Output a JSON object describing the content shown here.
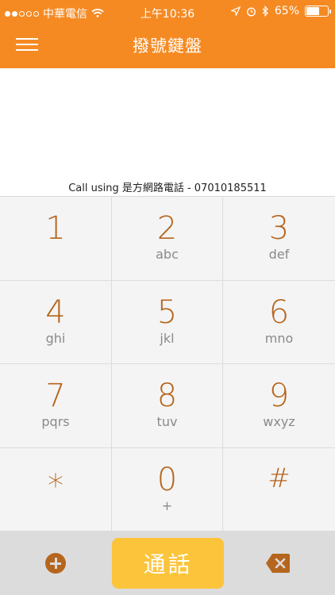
{
  "status_bar": {
    "carrier": "中華電信",
    "time": "上午10:36",
    "battery": "65%",
    "battery_level": 0.65,
    "signal_bars_filled": 2,
    "signal_bars_total": 5
  },
  "nav": {
    "title": "撥號鍵盤",
    "menu_icon": "hamburger-icon"
  },
  "display": {
    "number": ""
  },
  "call_using": "Call using 是方網路電話 - 07010185511",
  "keypad": [
    {
      "digit": "1",
      "letters": ""
    },
    {
      "digit": "2",
      "letters": "abc"
    },
    {
      "digit": "3",
      "letters": "def"
    },
    {
      "digit": "4",
      "letters": "ghi"
    },
    {
      "digit": "5",
      "letters": "jkl"
    },
    {
      "digit": "6",
      "letters": "mno"
    },
    {
      "digit": "7",
      "letters": "pqrs"
    },
    {
      "digit": "8",
      "letters": "tuv"
    },
    {
      "digit": "9",
      "letters": "wxyz"
    },
    {
      "digit": "*",
      "letters": ""
    },
    {
      "digit": "0",
      "letters": "+"
    },
    {
      "digit": "#",
      "letters": ""
    }
  ],
  "bottom": {
    "call_label": "通話",
    "add_icon": "plus-circle-icon",
    "delete_icon": "backspace-icon"
  },
  "colors": {
    "accent": "#f58a23",
    "key_text": "#b5651d",
    "call_button": "#fcc43a"
  }
}
